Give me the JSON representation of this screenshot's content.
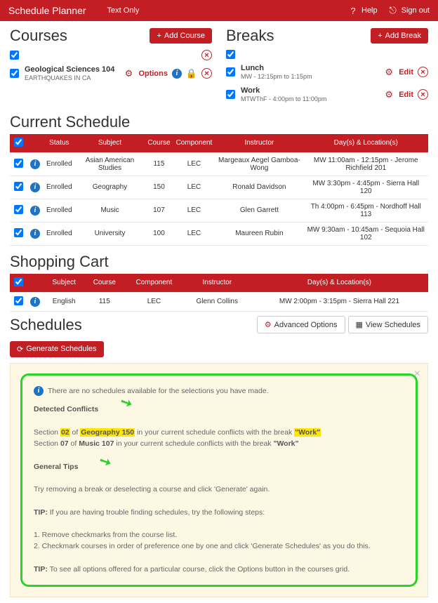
{
  "topbar": {
    "title": "Schedule Planner",
    "textonly": "Text Only",
    "help": "Help",
    "signout": "Sign out"
  },
  "courses": {
    "heading": "Courses",
    "add": "Add Course",
    "items": [
      {
        "t1": "",
        "t2": "",
        "opts": false
      },
      {
        "t1": "Geological Sciences 104",
        "t2": "EARTHQUAKES IN CA",
        "opts": true
      }
    ],
    "options_label": "Options"
  },
  "breaks": {
    "heading": "Breaks",
    "add": "Add Break",
    "edit": "Edit",
    "items": [
      {
        "t1": "Lunch",
        "t3": "MW - 12:15pm to 1:15pm"
      },
      {
        "t1": "Work",
        "t3": "MTWThF - 4:00pm to 11:00pm"
      }
    ]
  },
  "current": {
    "heading": "Current Schedule",
    "cols": [
      "",
      "",
      "Status",
      "Subject",
      "Course",
      "Component",
      "Instructor",
      "Day(s) & Location(s)"
    ],
    "rows": [
      {
        "status": "Enrolled",
        "subject": "Asian American Studies",
        "course": "115",
        "comp": "LEC",
        "instr": "Margeaux Aegel Gamboa-Wong",
        "loc": "MW 11:00am - 12:15pm - Jerome Richfield 201"
      },
      {
        "status": "Enrolled",
        "subject": "Geography",
        "course": "150",
        "comp": "LEC",
        "instr": "Ronald Davidson",
        "loc": "MW 3:30pm - 4:45pm - Sierra Hall 120"
      },
      {
        "status": "Enrolled",
        "subject": "Music",
        "course": "107",
        "comp": "LEC",
        "instr": "Glen Garrett",
        "loc": "Th 4:00pm - 6:45pm - Nordhoff Hall 113"
      },
      {
        "status": "Enrolled",
        "subject": "University",
        "course": "100",
        "comp": "LEC",
        "instr": "Maureen Rubin",
        "loc": "MW 9:30am - 10:45am - Sequoia Hall 102"
      }
    ]
  },
  "cart": {
    "heading": "Shopping Cart",
    "cols": [
      "",
      "",
      "Subject",
      "Course",
      "Component",
      "Instructor",
      "Day(s) & Location(s)"
    ],
    "rows": [
      {
        "subject": "English",
        "course": "115",
        "comp": "LEC",
        "instr": "Glenn Collins",
        "loc": "MW 2:00pm - 3:15pm - Sierra Hall 221"
      }
    ]
  },
  "schedules": {
    "heading": "Schedules",
    "generate": "Generate Schedules",
    "adv": "Advanced Options",
    "view": "View Schedules"
  },
  "alert": {
    "msg": "There are no schedules available for the selections you have made.",
    "h1": "Detected Conflicts",
    "h2": "General Tips",
    "c1a": "Section ",
    "c1b": "02",
    "c1c": " of ",
    "c1d": "Geography 150",
    "c1e": " in your current schedule conflicts with the break ",
    "c1f": "\"Work\"",
    "c2a": "Section ",
    "c2b": "07",
    "c2c": " of ",
    "c2d": "Music 107",
    "c2e": " in your current schedule conflicts with the break ",
    "c2f": "\"Work\"",
    "g1": "Try removing a break or deselecting a course and click 'Generate' again.",
    "g2": "TIP:",
    "g2b": " If you are having trouble finding schedules, try the following steps:",
    "g3": "1. Remove checkmarks from the course list.",
    "g4": "2. Checkmark courses in order of preference one by one and click 'Generate Schedules' as you do this.",
    "g5": "TIP:",
    "g5b": " To see all options offered for a particular course, click the Options button in the courses grid."
  }
}
